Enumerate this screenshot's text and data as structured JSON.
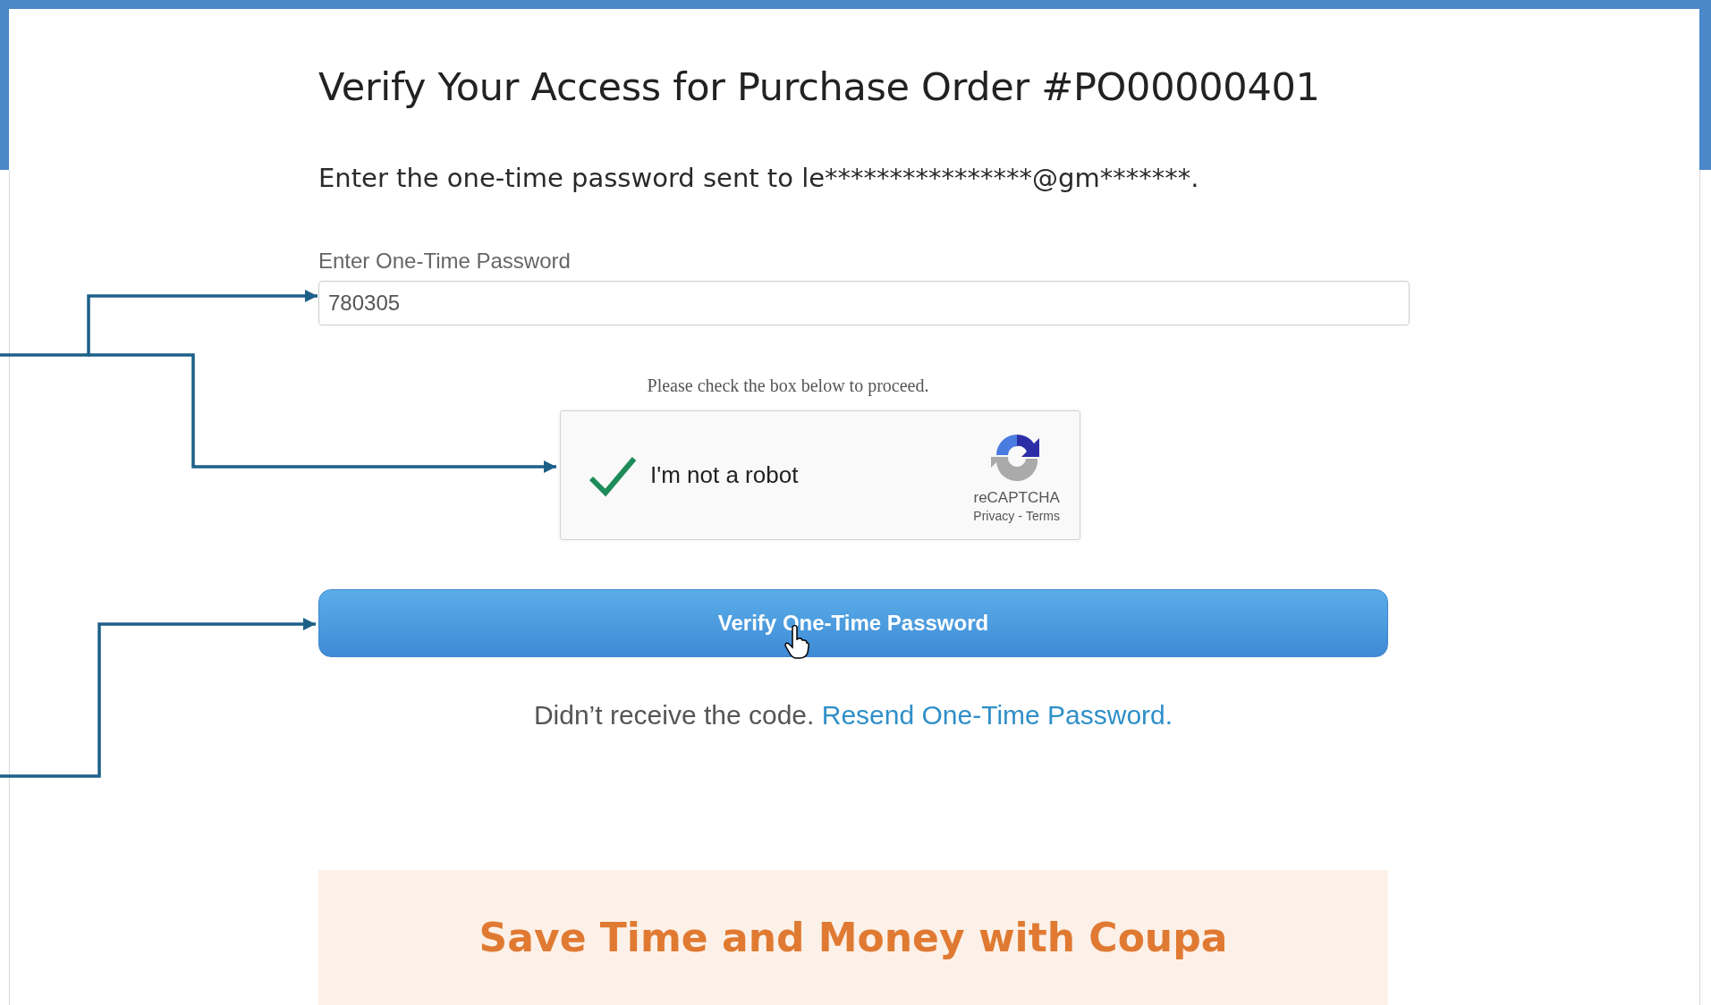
{
  "title": "Verify Your Access for Purchase Order #PO00000401",
  "instruction": "Enter the one-time password sent to le****************@gm*******.",
  "otp_field": {
    "label": "Enter One-Time Password",
    "value": "780305"
  },
  "captcha_prompt": "Please check the box below to proceed.",
  "captcha": {
    "label": "I'm not a robot",
    "checked": true,
    "brand": "reCAPTCHA",
    "privacy": "Privacy",
    "separator": "-",
    "terms": "Terms"
  },
  "verify_button": "Verify One-Time Password",
  "resend": {
    "text": "Didn’t receive the code.",
    "link": "Resend One-Time Password."
  },
  "banner": {
    "title": "Save Time and Money with Coupa"
  }
}
